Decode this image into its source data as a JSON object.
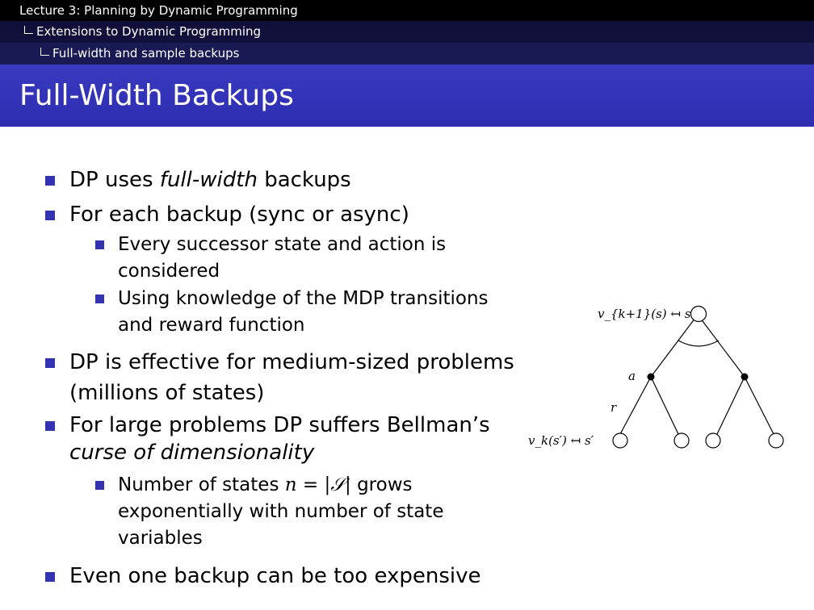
{
  "header": {
    "lecture": "Lecture 3: Planning by Dynamic Programming",
    "section": "Extensions to Dynamic Programming",
    "subsection": "Full-width and sample backups"
  },
  "slide": {
    "title": "Full-Width Backups",
    "bullets": {
      "b1_pre": "DP uses ",
      "b1_em": "full-width",
      "b1_post": " backups",
      "b2": "For each backup (sync or async)",
      "b2_sub1_line1": "Every successor state and action is",
      "b2_sub1_line2": "considered",
      "b2_sub2_line1": "Using knowledge of the MDP transitions",
      "b2_sub2_line2": "and reward function",
      "b3_line1": "DP is effective for medium-sized problems",
      "b3_line2": "(millions of states)",
      "b4_line1": "For large problems DP suffers Bellman’s",
      "b4_line2": "curse of dimensionality",
      "b4_sub1_pre": "Number of states ",
      "b4_sub1_math": "n = |𝒮|",
      "b4_sub1_post": " grows",
      "b4_sub1_line2": "exponentially with number of state",
      "b4_sub1_line3": "variables",
      "b5": "Even one backup can be too expensive"
    }
  },
  "diagram": {
    "top_label": "v_{k+1}(s) ↤ s",
    "action_label": "a",
    "reward_label": "r",
    "bottom_label": "v_k(s′) ↤ s′"
  }
}
